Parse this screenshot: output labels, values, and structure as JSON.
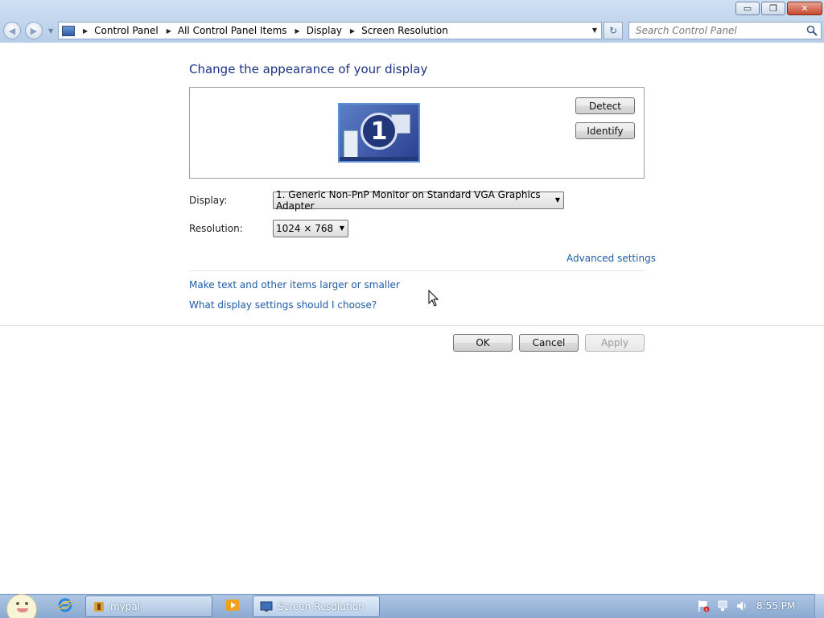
{
  "window": {
    "minimize_glyph": "▭",
    "restore_glyph": "❐",
    "close_glyph": "✕"
  },
  "nav": {
    "back_glyph": "◀",
    "forward_glyph": "▶",
    "breadcrumbs": [
      "Control Panel",
      "All Control Panel Items",
      "Display",
      "Screen Resolution"
    ],
    "refresh_glyph": "↻",
    "search_placeholder": "Search Control Panel"
  },
  "page": {
    "title": "Change the appearance of your display",
    "monitor_number": "1",
    "detect_label": "Detect",
    "identify_label": "Identify",
    "display_label": "Display:",
    "display_value": "1. Generic Non-PnP Monitor on Standard VGA Graphics Adapter",
    "resolution_label": "Resolution:",
    "resolution_value": "1024 × 768",
    "advanced_link": "Advanced settings",
    "link_text_size": "Make text and other items larger or smaller",
    "link_help": "What display settings should I choose?",
    "ok_label": "OK",
    "cancel_label": "Cancel",
    "apply_label": "Apply"
  },
  "taskbar": {
    "items": [
      {
        "label": "mypal",
        "active": false
      },
      {
        "label": "Screen Resolution",
        "active": true
      }
    ],
    "clock": "8:55 PM"
  },
  "colors": {
    "title_blue": "#1e3287",
    "link_blue": "#1e5ba5",
    "close_red": "#c7462d"
  }
}
